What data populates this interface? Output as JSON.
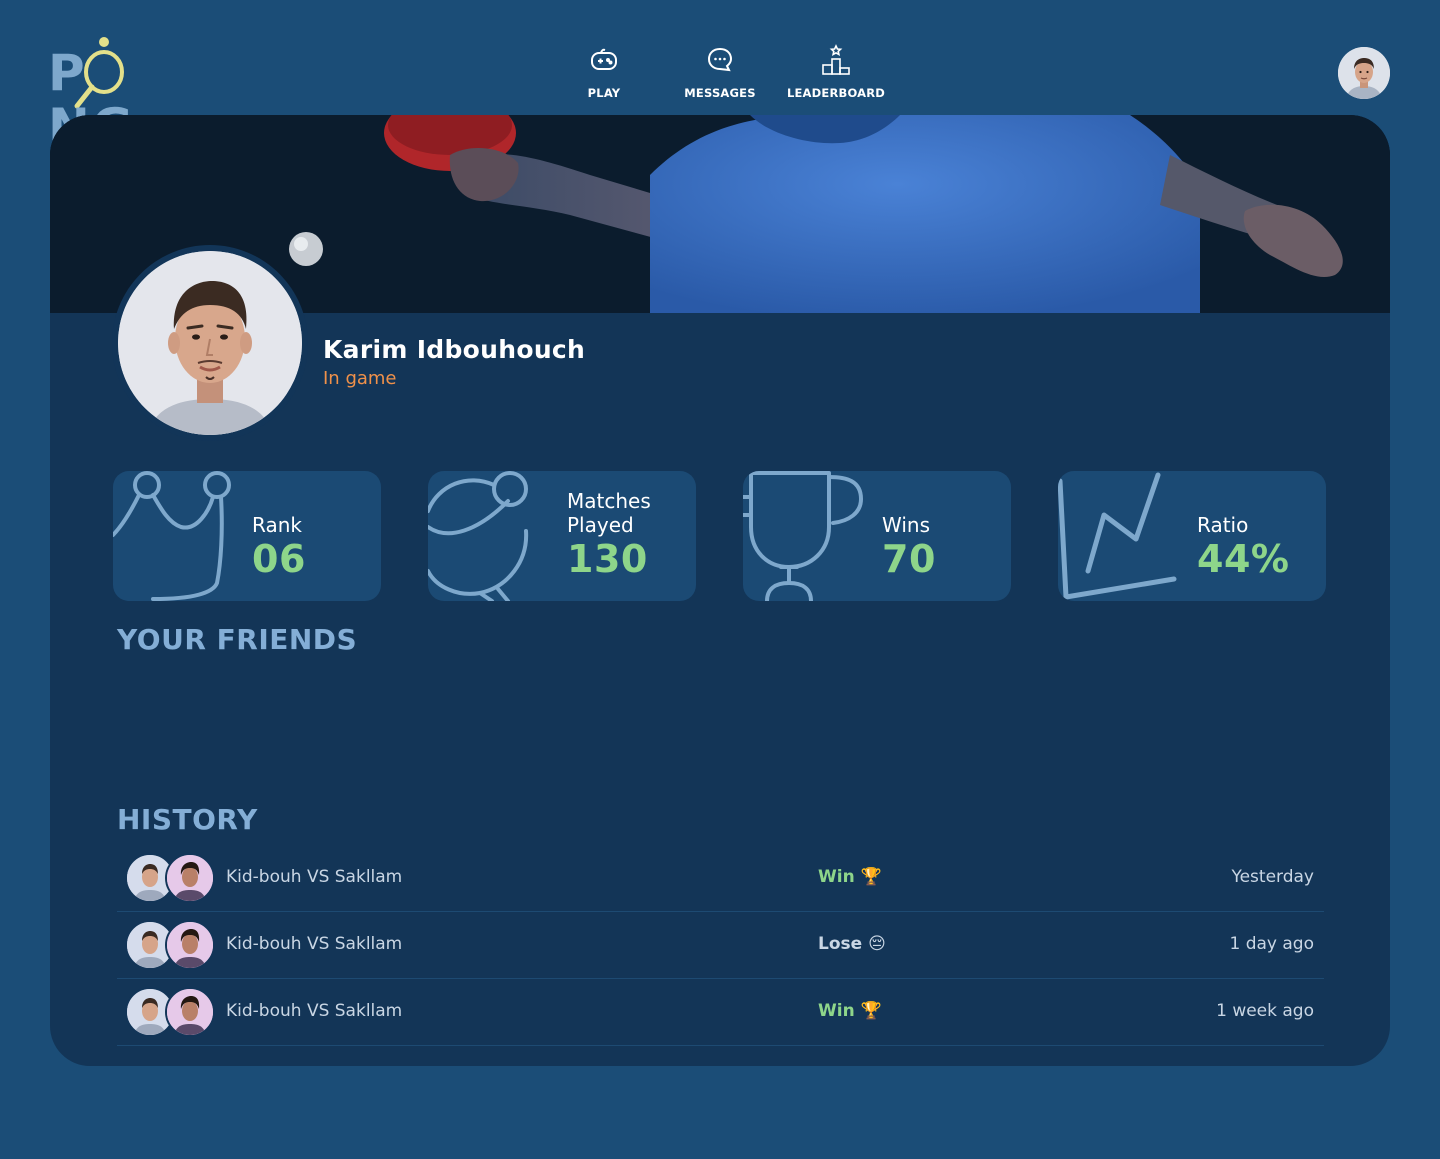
{
  "brand": {
    "logo_text_left": "P",
    "logo_text_right": "NG"
  },
  "nav": [
    {
      "label": "PLAY",
      "icon": "gamepad-icon"
    },
    {
      "label": "MESSAGES",
      "icon": "chat-bubble-icon"
    },
    {
      "label": "LEADERBOARD",
      "icon": "podium-icon"
    }
  ],
  "profile": {
    "name": "Karim Idbouhouch",
    "status": "In game"
  },
  "stats": [
    {
      "label": "Rank",
      "value": "06",
      "icon": "crown-icon"
    },
    {
      "label": "Matches Played",
      "label_line1": "Matches",
      "label_line2": "Played",
      "value": "130",
      "icon": "ping-pong-paddle-icon"
    },
    {
      "label": "Wins",
      "value": "70",
      "icon": "trophy-icon"
    },
    {
      "label": "Ratio",
      "value": "44%",
      "icon": "line-chart-icon"
    }
  ],
  "sections": {
    "friends_title": "YOUR FRIENDS",
    "history_title": "HISTORY"
  },
  "history": [
    {
      "match": "Kid-bouh VS Sakllam",
      "result": "Win",
      "result_emoji": "🏆",
      "when": "Yesterday"
    },
    {
      "match": "Kid-bouh VS Sakllam",
      "result": "Lose",
      "result_emoji": "😔",
      "when": "1 day ago"
    },
    {
      "match": "Kid-bouh VS Sakllam",
      "result": "Win",
      "result_emoji": "🏆",
      "when": "1 week ago"
    }
  ],
  "colors": {
    "page_bg": "#1b4d77",
    "card_bg": "#133557",
    "stat_bg": "#1b4a74",
    "accent_green": "#8ed58a",
    "status_orange": "#f0914a",
    "title_blue": "#84aed6"
  }
}
